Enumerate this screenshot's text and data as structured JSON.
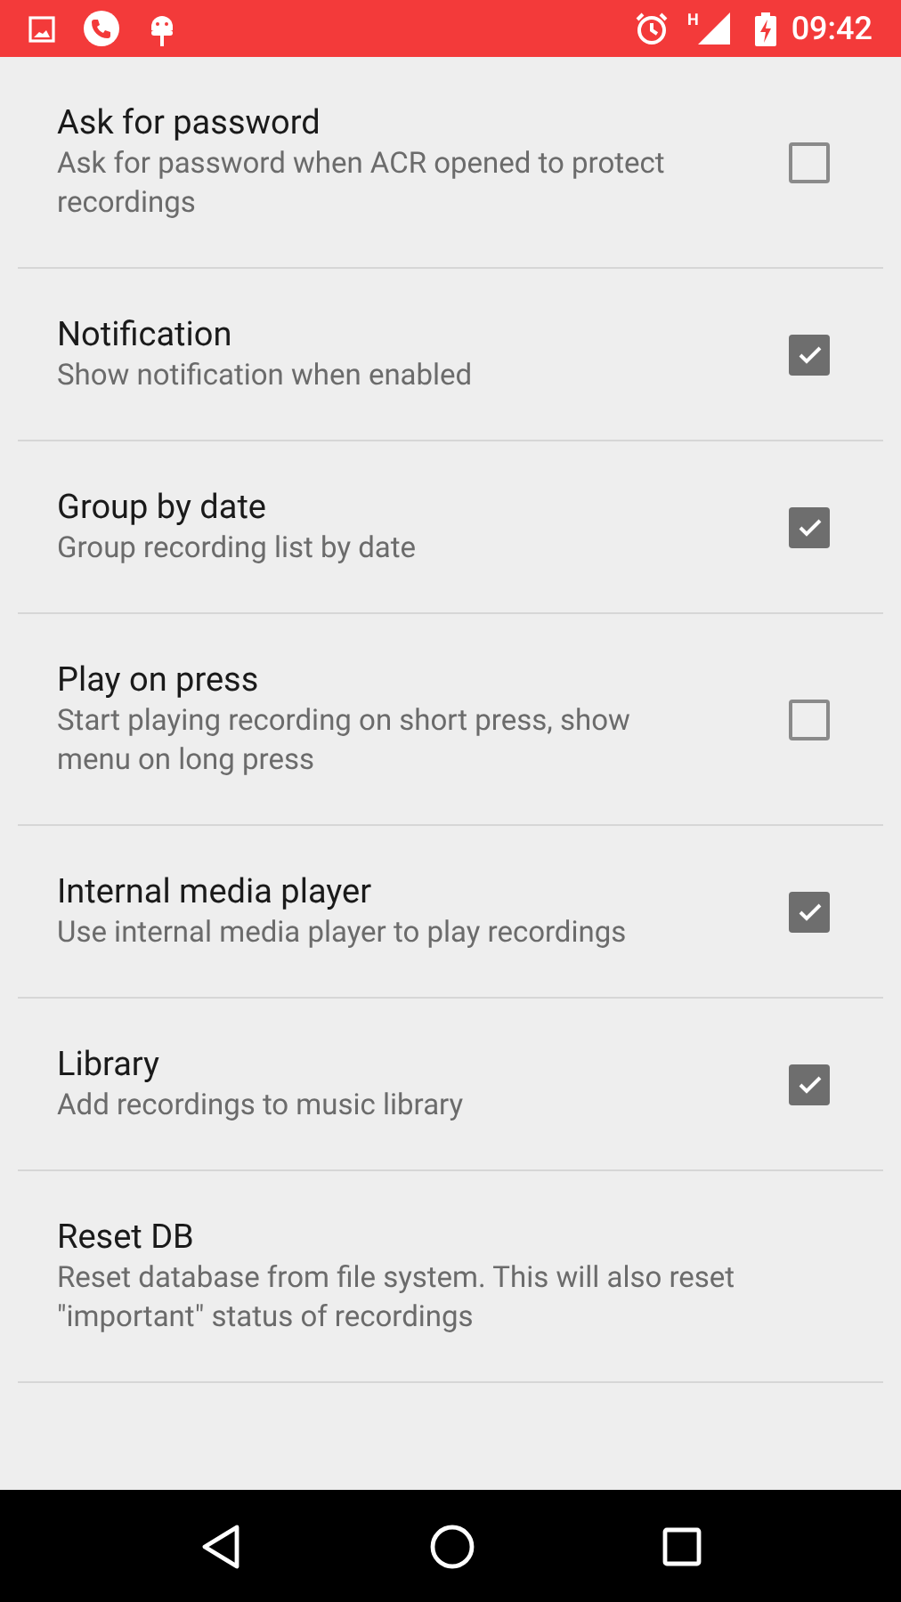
{
  "status_bar": {
    "time": "09:42",
    "network": "H"
  },
  "settings": [
    {
      "kind": "checkbox",
      "title": "Ask for password",
      "summary": "Ask for password when ACR opened to protect recordings",
      "checked": false
    },
    {
      "kind": "checkbox",
      "title": "Notification",
      "summary": "Show notification when enabled",
      "checked": true
    },
    {
      "kind": "checkbox",
      "title": "Group by date",
      "summary": "Group recording list by date",
      "checked": true
    },
    {
      "kind": "checkbox",
      "title": "Play on press",
      "summary": "Start playing recording on short press, show menu on long press",
      "checked": false
    },
    {
      "kind": "checkbox",
      "title": "Internal media player",
      "summary": "Use internal media player to play recordings",
      "checked": true
    },
    {
      "kind": "checkbox",
      "title": "Library",
      "summary": "Add recordings to music library",
      "checked": true
    },
    {
      "kind": "action",
      "title": "Reset DB",
      "summary": "Reset database from file system. This will also reset \"important\" status of recordings"
    }
  ]
}
